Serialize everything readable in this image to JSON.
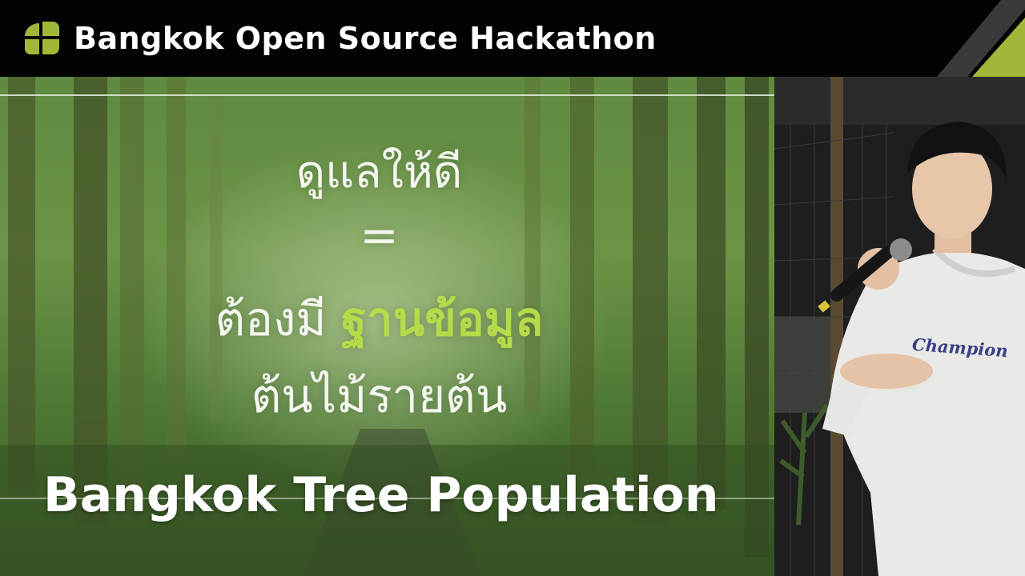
{
  "banner": {
    "title": "Bangkok Open Source Hackathon",
    "logo_icon": "four-leaf-logo-icon",
    "accent_color": "#9fb83a"
  },
  "slide": {
    "line1": "ดูแลให้ดี",
    "equals": "=",
    "line3_prefix": "ต้องมี ",
    "line3_highlight": "ฐานข้อมูล",
    "line4": "ต้นไม้รายต้น",
    "highlight_color": "#b6db4a"
  },
  "lower_third": {
    "title": "Bangkok Tree Population"
  },
  "camera": {
    "shirt_logo": "Champion"
  }
}
